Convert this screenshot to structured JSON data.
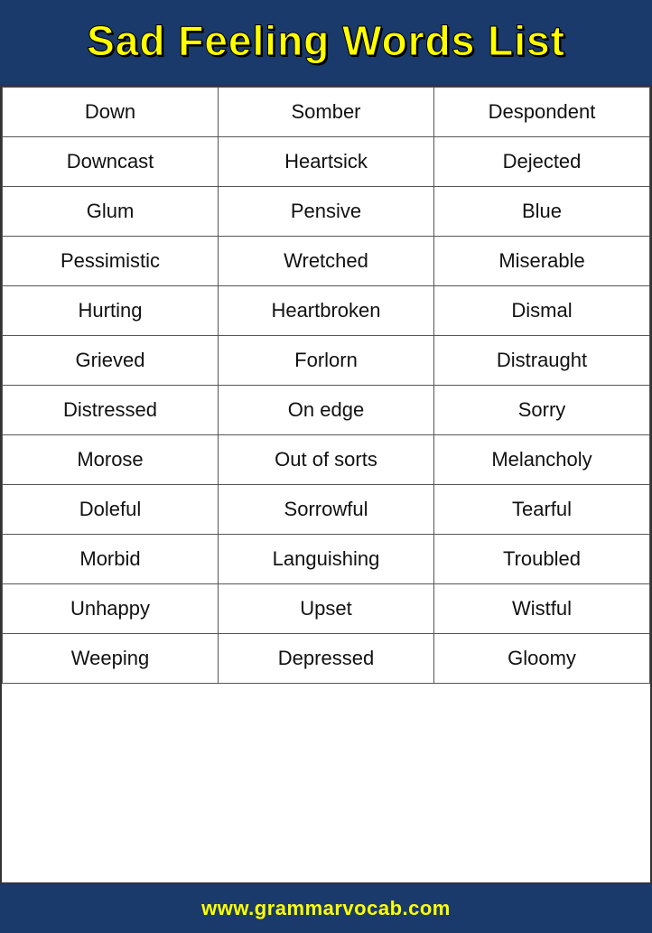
{
  "header": {
    "title": "Sad Feeling Words List"
  },
  "table": {
    "rows": [
      [
        "Down",
        "Somber",
        "Despondent"
      ],
      [
        "Downcast",
        "Heartsick",
        "Dejected"
      ],
      [
        "Glum",
        "Pensive",
        "Blue"
      ],
      [
        "Pessimistic",
        "Wretched",
        "Miserable"
      ],
      [
        "Hurting",
        "Heartbroken",
        "Dismal"
      ],
      [
        "Grieved",
        "Forlorn",
        "Distraught"
      ],
      [
        "Distressed",
        "On edge",
        "Sorry"
      ],
      [
        "Morose",
        "Out of sorts",
        "Melancholy"
      ],
      [
        "Doleful",
        "Sorrowful",
        "Tearful"
      ],
      [
        "Morbid",
        "Languishing",
        "Troubled"
      ],
      [
        "Unhappy",
        "Upset",
        "Wistful"
      ],
      [
        "Weeping",
        "Depressed",
        "Gloomy"
      ]
    ]
  },
  "footer": {
    "url": "www.grammarvocab.com"
  }
}
